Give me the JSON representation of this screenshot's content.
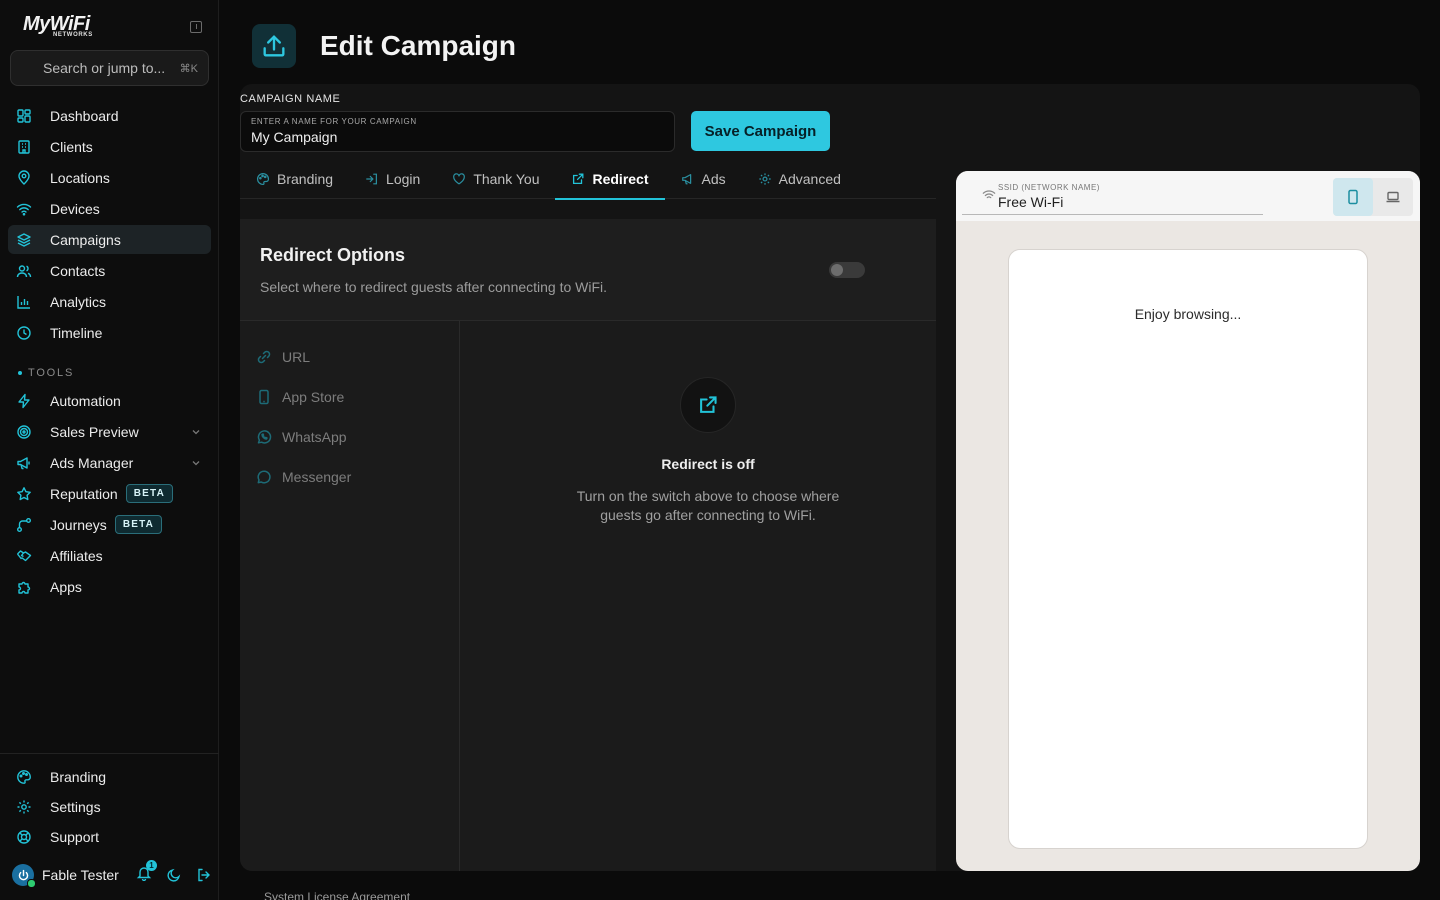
{
  "app": {
    "logo_main": "MyWiFi",
    "logo_sub": "NETWORKS"
  },
  "search": {
    "placeholder": "Search or jump to...",
    "shortcut": "⌘K"
  },
  "nav": {
    "items": [
      {
        "label": "Dashboard",
        "icon": "dashboard-icon"
      },
      {
        "label": "Clients",
        "icon": "building-icon"
      },
      {
        "label": "Locations",
        "icon": "map-pin-icon"
      },
      {
        "label": "Devices",
        "icon": "wifi-icon"
      },
      {
        "label": "Campaigns",
        "icon": "layers-icon",
        "active": true
      },
      {
        "label": "Contacts",
        "icon": "users-icon"
      },
      {
        "label": "Analytics",
        "icon": "bar-chart-icon"
      },
      {
        "label": "Timeline",
        "icon": "clock-icon"
      }
    ],
    "tools_label": "TOOLS",
    "tools": [
      {
        "label": "Automation",
        "icon": "bolt-icon"
      },
      {
        "label": "Sales Preview",
        "icon": "target-icon",
        "expandable": true
      },
      {
        "label": "Ads Manager",
        "icon": "megaphone-icon",
        "expandable": true
      },
      {
        "label": "Reputation",
        "icon": "star-icon",
        "badge": "BETA"
      },
      {
        "label": "Journeys",
        "icon": "route-icon",
        "badge": "BETA"
      },
      {
        "label": "Affiliates",
        "icon": "handshake-icon"
      },
      {
        "label": "Apps",
        "icon": "puzzle-icon"
      }
    ],
    "bottom": [
      {
        "label": "Branding",
        "icon": "palette-icon"
      },
      {
        "label": "Settings",
        "icon": "gear-icon"
      },
      {
        "label": "Support",
        "icon": "lifebuoy-icon"
      }
    ]
  },
  "user": {
    "name": "Fable Tester",
    "notification_count": "1"
  },
  "page": {
    "title": "Edit Campaign"
  },
  "campaign": {
    "field_label": "CAMPAIGN NAME",
    "input_label": "ENTER A NAME FOR YOUR CAMPAIGN",
    "input_value": "My Campaign",
    "save_label": "Save Campaign"
  },
  "tabs": [
    {
      "label": "Branding",
      "icon": "palette-icon"
    },
    {
      "label": "Login",
      "icon": "login-icon"
    },
    {
      "label": "Thank You",
      "icon": "heart-icon"
    },
    {
      "label": "Redirect",
      "icon": "external-link-icon",
      "active": true
    },
    {
      "label": "Ads",
      "icon": "megaphone-icon"
    },
    {
      "label": "Advanced",
      "icon": "gear-icon"
    }
  ],
  "redirect": {
    "title": "Redirect Options",
    "subtitle": "Select where to redirect guests after connecting to WiFi.",
    "enabled": false,
    "options": [
      {
        "label": "URL",
        "icon": "link-icon"
      },
      {
        "label": "App Store",
        "icon": "smartphone-icon"
      },
      {
        "label": "WhatsApp",
        "icon": "whatsapp-icon"
      },
      {
        "label": "Messenger",
        "icon": "chat-bubble-icon"
      }
    ],
    "empty_title": "Redirect is off",
    "empty_desc": "Turn on the switch above to choose where guests go after connecting to WiFi."
  },
  "preview": {
    "ssid_label": "SSID (NETWORK NAME)",
    "ssid_value": "Free Wi-Fi",
    "phone_text": "Enjoy browsing..."
  },
  "footer": {
    "link": "System License Agreement"
  },
  "colors": {
    "accent": "#22c3d8",
    "save_button": "#2ec8e0"
  }
}
